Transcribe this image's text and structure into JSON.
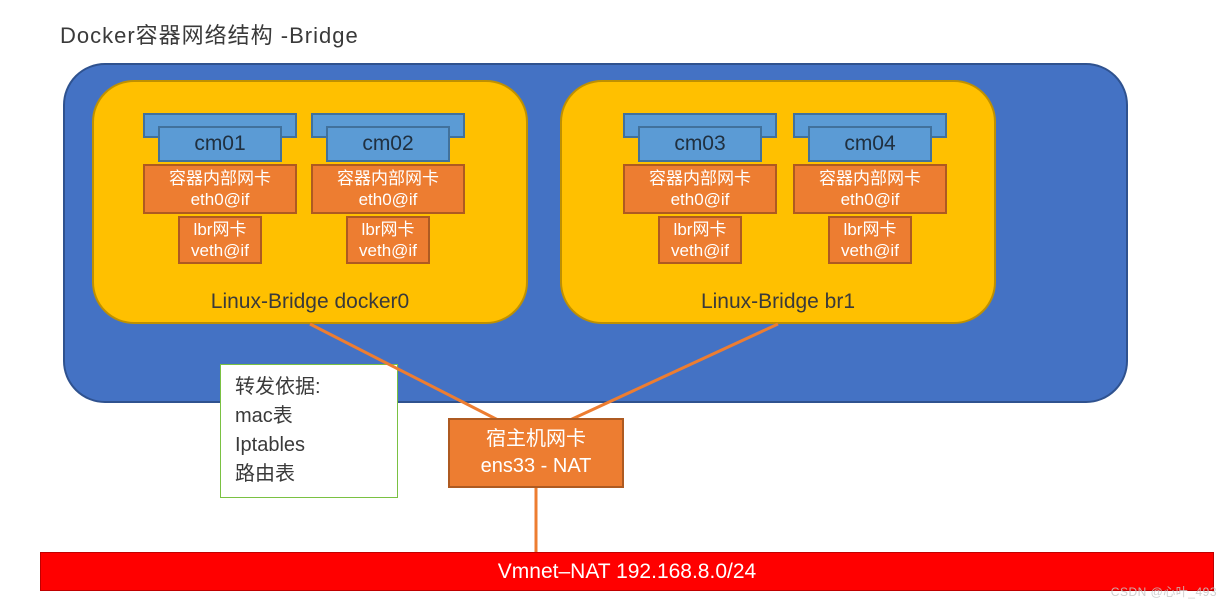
{
  "title": "Docker容器网络结构 -Bridge",
  "bridges": [
    {
      "label": "Linux-Bridge docker0"
    },
    {
      "label": "Linux-Bridge br1"
    }
  ],
  "containers": [
    {
      "name": "cm01",
      "nic_label": "容器内部网卡",
      "nic_if": "eth0@if",
      "veth_label": "lbr网卡",
      "veth_if": "veth@if"
    },
    {
      "name": "cm02",
      "nic_label": "容器内部网卡",
      "nic_if": "eth0@if",
      "veth_label": "lbr网卡",
      "veth_if": "veth@if"
    },
    {
      "name": "cm03",
      "nic_label": "容器内部网卡",
      "nic_if": "eth0@if",
      "veth_label": "lbr网卡",
      "veth_if": "veth@if"
    },
    {
      "name": "cm04",
      "nic_label": "容器内部网卡",
      "nic_if": "eth0@if",
      "veth_label": "lbr网卡",
      "veth_if": "veth@if"
    }
  ],
  "info": {
    "line1": "转发依据:",
    "line2": "mac表",
    "line3": "Iptables",
    "line4": "路由表"
  },
  "host_nic": {
    "line1": "宿主机网卡",
    "line2": "ens33 - NAT"
  },
  "vmnet": "Vmnet–NAT  192.168.8.0/24",
  "watermark": "CSDN @心叶_493",
  "colors": {
    "host_bg": "#4472C4",
    "bridge_bg": "#FFC000",
    "container_bg": "#5B9BD5",
    "nic_bg": "#ED7D31",
    "vmnet_bg": "#FF0000",
    "line": "#ED7D31"
  }
}
